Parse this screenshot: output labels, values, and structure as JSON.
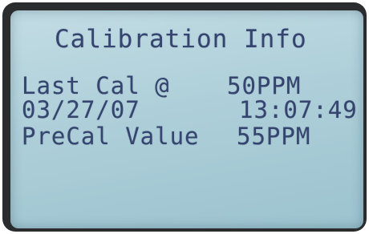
{
  "screen": {
    "title": "Calibration Info",
    "rows": [
      {
        "label": "Last Cal @",
        "value": "50PPM"
      },
      {
        "label": "03/27/07",
        "value": "13:07:49"
      },
      {
        "label": "PreCal Value",
        "value": "55PPM"
      }
    ]
  },
  "colors": {
    "lcd_background": "#aecfd9",
    "lcd_text": "#36456f",
    "bezel": "#2a2c2e"
  }
}
